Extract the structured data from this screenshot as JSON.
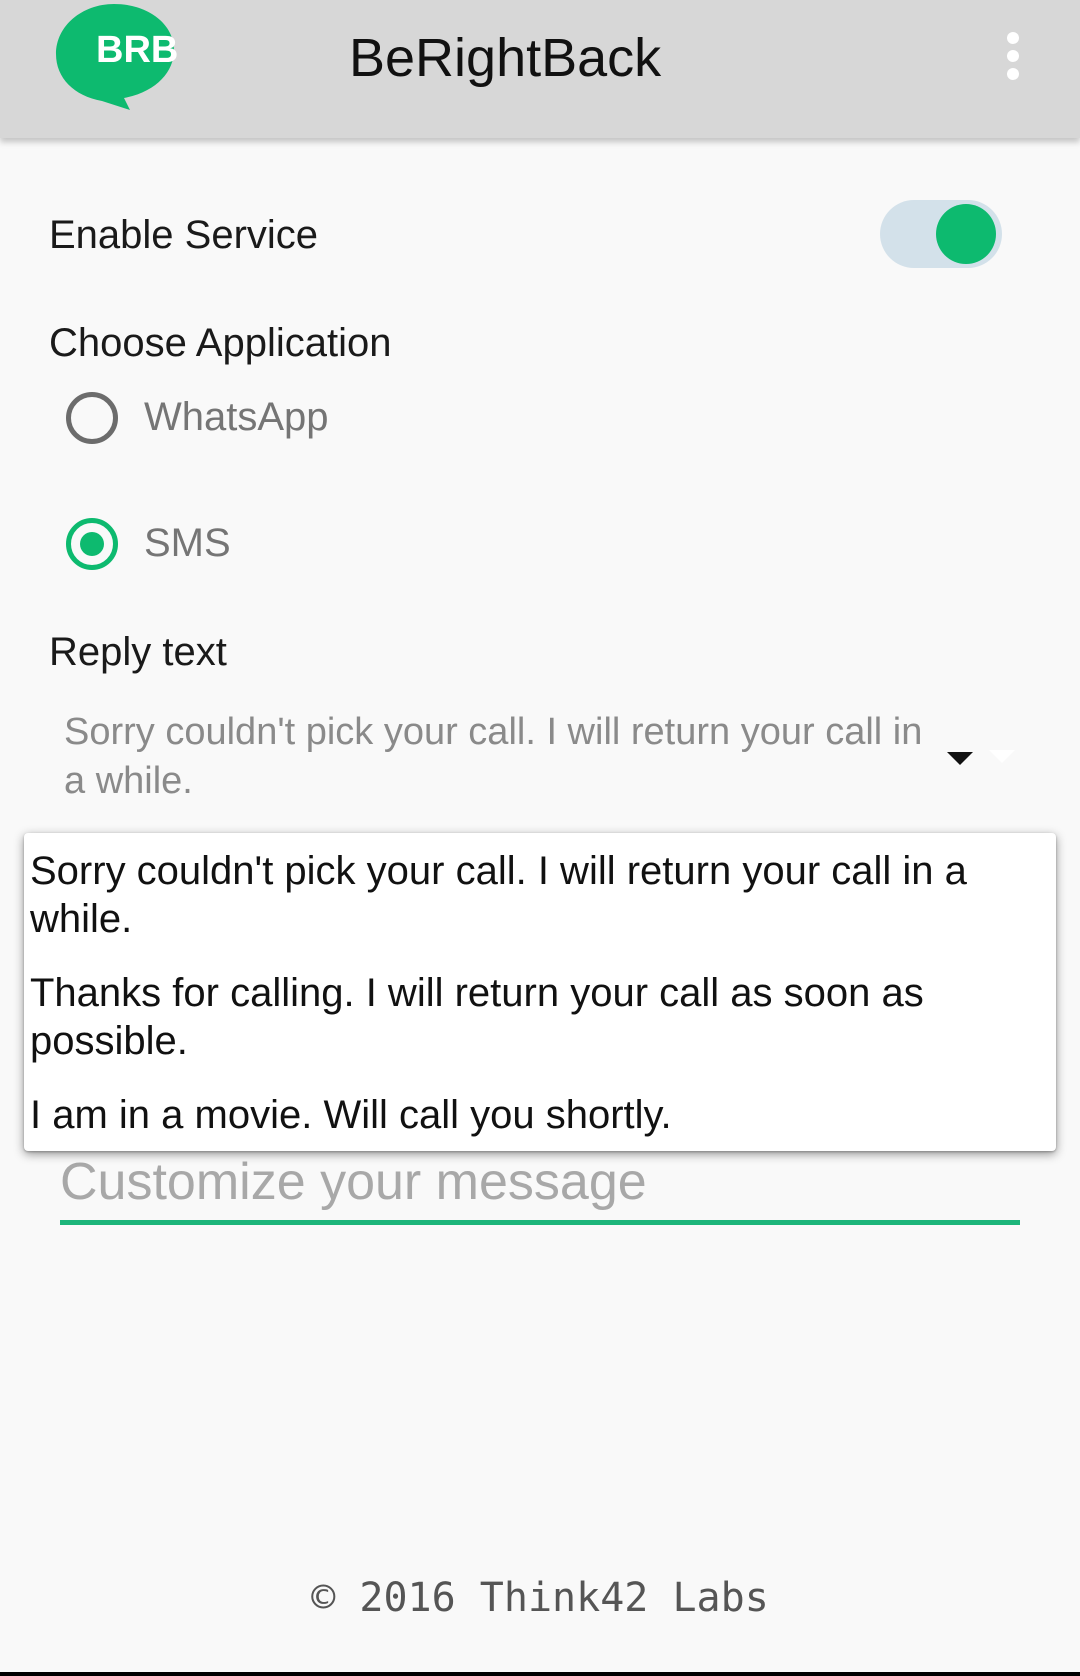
{
  "app_bar": {
    "logo_text": "BRB",
    "title": "BeRightBack",
    "menu_icon": "more-vert-icon"
  },
  "colors": {
    "accent": "#0dba6f",
    "app_bar": "#d7d7d7",
    "switch_track": "#d3e1ea"
  },
  "enable_service": {
    "label": "Enable Service",
    "enabled": true
  },
  "choose_application": {
    "label": "Choose Application",
    "options": [
      {
        "label": "WhatsApp",
        "selected": false
      },
      {
        "label": "SMS",
        "selected": true
      }
    ]
  },
  "reply_text": {
    "label": "Reply text",
    "selected": "Sorry couldn't pick your call. I will return your call in a while.",
    "options": [
      "Sorry couldn't pick your call. I will return your call in a while.",
      "Thanks for calling. I will return your call as soon as possible.",
      "I am in a movie. Will call you shortly."
    ]
  },
  "custom_message": {
    "placeholder": "Customize your message",
    "value": ""
  },
  "footer": {
    "text": "© 2016 Think42 Labs"
  }
}
